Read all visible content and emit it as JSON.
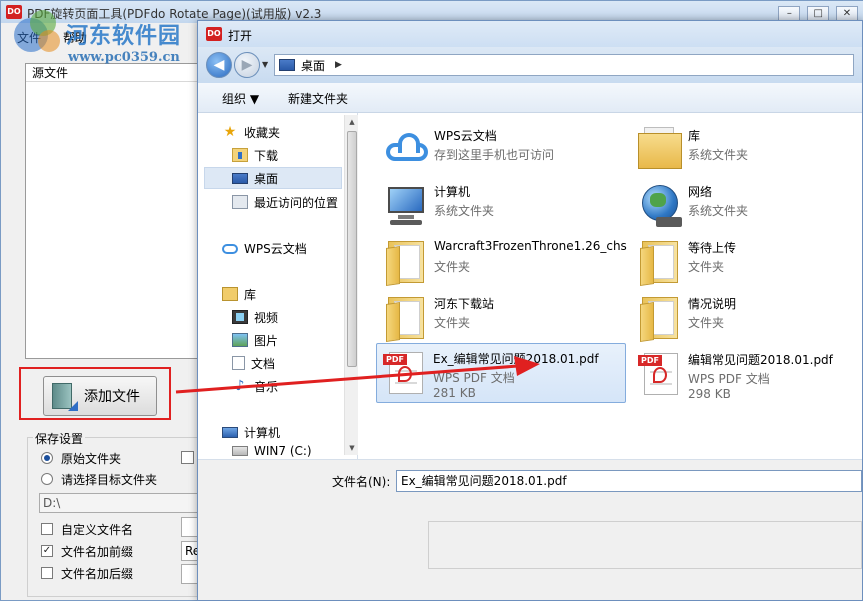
{
  "app": {
    "icon_text": "DO",
    "title": "PDF旋转页面工具(PDFdo Rotate Page)(试用版) v2.3",
    "menu": [
      "文件",
      "帮助"
    ],
    "source_list_header": "源文件",
    "add_file_label": "添加文件",
    "save_settings": {
      "legend": "保存设置",
      "radio_original": "原始文件夹",
      "radio_target": "请选择目标文件夹",
      "path": "D:\\",
      "custom_name": "自定义文件名",
      "prefix": "文件名加前缀",
      "prefix_value": "Removed_",
      "suffix": "文件名加后缀"
    },
    "window_buttons": [
      "–",
      "□",
      "✕"
    ]
  },
  "watermark": {
    "name": "河东软件园",
    "url": "www.pc0359.cn"
  },
  "dialog": {
    "icon_text": "DO",
    "title": "打开",
    "address": "桌面",
    "toolbar": {
      "organize": "组织 ▼",
      "new_folder": "新建文件夹"
    },
    "tree": [
      {
        "label": "收藏夹",
        "icon": "star-icon"
      },
      {
        "label": "下载",
        "icon": "download-folder-icon"
      },
      {
        "label": "桌面",
        "icon": "desktop-icon"
      },
      {
        "label": "最近访问的位置",
        "icon": "recent-places-icon"
      },
      {
        "label": "WPS云文档",
        "icon": "cloud-icon"
      },
      {
        "label": "库",
        "icon": "library-icon"
      },
      {
        "label": "视频",
        "icon": "video-icon"
      },
      {
        "label": "图片",
        "icon": "picture-icon"
      },
      {
        "label": "文档",
        "icon": "document-icon"
      },
      {
        "label": "音乐",
        "icon": "music-icon"
      },
      {
        "label": "计算机",
        "icon": "computer-icon"
      },
      {
        "label": "WIN7 (C:)",
        "icon": "drive-icon"
      }
    ],
    "files": [
      {
        "name": "WPS云文档",
        "sub": "存到这里手机也可访问",
        "size": "",
        "icon": "cloud-icon"
      },
      {
        "name": "库",
        "sub": "系统文件夹",
        "size": "",
        "icon": "library-icon"
      },
      {
        "name": "计算机",
        "sub": "系统文件夹",
        "size": "",
        "icon": "computer-icon"
      },
      {
        "name": "网络",
        "sub": "系统文件夹",
        "size": "",
        "icon": "network-icon"
      },
      {
        "name": "Warcraft3FrozenThrone1.26_chs",
        "sub": "文件夹",
        "size": "",
        "icon": "folder-icon"
      },
      {
        "name": "等待上传",
        "sub": "文件夹",
        "size": "",
        "icon": "folder-icon"
      },
      {
        "name": "河东下载站",
        "sub": "文件夹",
        "size": "",
        "icon": "folder-icon"
      },
      {
        "name": "情况说明",
        "sub": "文件夹",
        "size": "",
        "icon": "folder-icon"
      },
      {
        "name": "Ex_编辑常见问题2018.01.pdf",
        "sub": "WPS PDF 文档",
        "size": "281 KB",
        "icon": "pdf-icon"
      },
      {
        "name": "编辑常见问题2018.01.pdf",
        "sub": "WPS PDF 文档",
        "size": "298 KB",
        "icon": "pdf-icon"
      }
    ],
    "pdf_tag": "PDF",
    "filename_label": "文件名(N):",
    "filename_value": "Ex_编辑常见问题2018.01.pdf"
  },
  "colors": {
    "highlight": "#e02020",
    "arrow": "#e02020",
    "selection": "#d5e5f8",
    "accent": "#2a6ac0"
  }
}
